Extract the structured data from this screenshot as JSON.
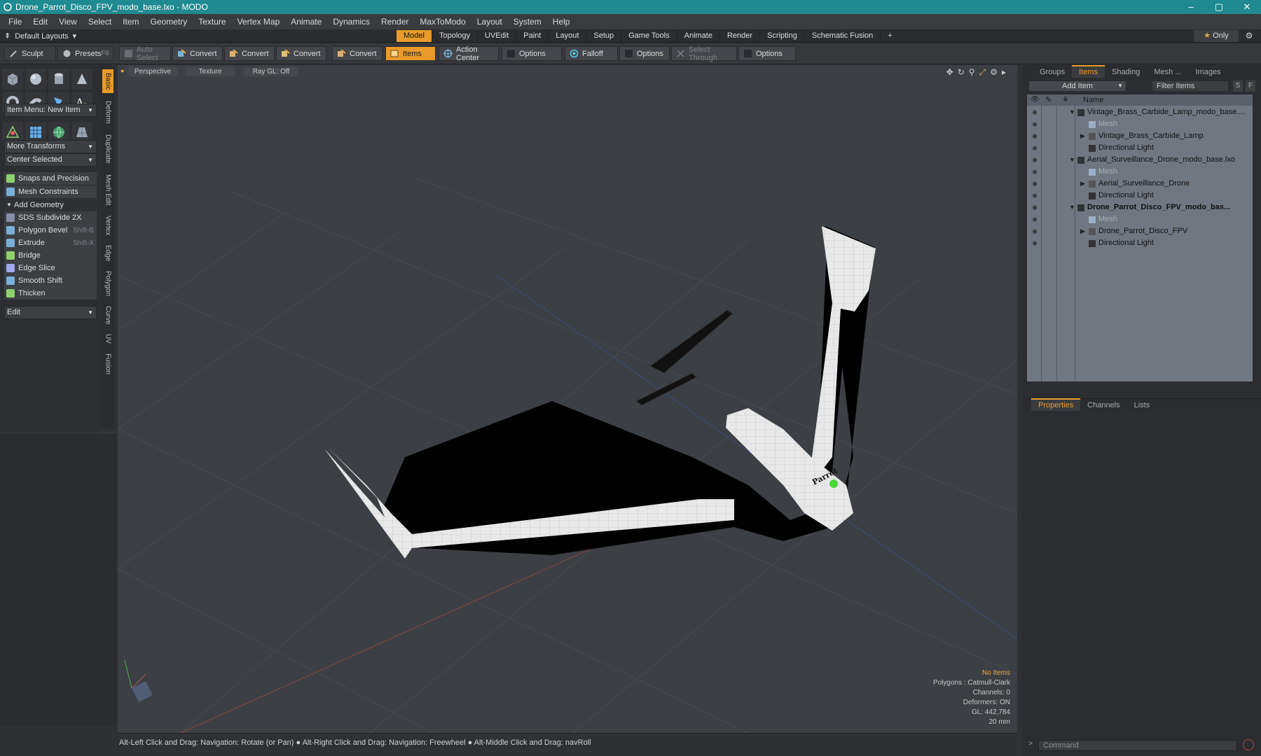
{
  "window": {
    "title": "Drone_Parrot_Disco_FPV_modo_base.lxo - MODO",
    "controls": [
      "–",
      "▢",
      "✕"
    ]
  },
  "menu": [
    "File",
    "Edit",
    "View",
    "Select",
    "Item",
    "Geometry",
    "Texture",
    "Vertex Map",
    "Animate",
    "Dynamics",
    "Render",
    "MaxToModo",
    "Layout",
    "System",
    "Help"
  ],
  "layoutbar": {
    "layouts_label": "Default Layouts",
    "tabs": [
      "Model",
      "Topology",
      "UVEdit",
      "Paint",
      "Layout",
      "Setup",
      "Game Tools",
      "Animate",
      "Render",
      "Scripting",
      "Schematic Fusion"
    ],
    "active_tab": "Model",
    "only_label": "Only",
    "plus": "+"
  },
  "toolbar": {
    "sculpt": "Sculpt",
    "presets": "Presets",
    "presets_key": "F6",
    "auto_select": "Auto Select",
    "convert1": "Convert",
    "convert2": "Convert",
    "convert3": "Convert",
    "convert4": "Convert",
    "items": "Items",
    "action_center": "Action Center",
    "options1": "Options",
    "falloff": "Falloff",
    "options2": "Options",
    "select_through": "Select Through",
    "options3": "Options"
  },
  "left": {
    "item_menu": "Item Menu: New Item",
    "more_transforms": "More Transforms",
    "center_selected": "Center Selected",
    "snaps": "Snaps and Precision",
    "mesh_constraints": "Mesh Constraints",
    "add_geometry": "Add Geometry",
    "tools": [
      {
        "label": "SDS Subdivide 2X",
        "key": "",
        "color": "#8a8fa8"
      },
      {
        "label": "Polygon Bevel",
        "key": "Shift-B",
        "color": "#7ab0d8"
      },
      {
        "label": "Extrude",
        "key": "Shift-X",
        "color": "#7ab0d8"
      },
      {
        "label": "Bridge",
        "key": "",
        "color": "#8fcf6f"
      },
      {
        "label": "Edge Slice",
        "key": "",
        "color": "#9fa8e8"
      },
      {
        "label": "Smooth Shift",
        "key": "",
        "color": "#7ab0d8"
      },
      {
        "label": "Thicken",
        "key": "",
        "color": "#8fcf6f"
      }
    ],
    "edit": "Edit"
  },
  "vtabs": [
    "Basic",
    "Deform",
    "Duplicate",
    "Mesh Edit",
    "Vertex",
    "Edge",
    "Polygon",
    "Curve",
    "UV",
    "Fusion"
  ],
  "viewport": {
    "perspective": "Perspective",
    "texture": "Texture",
    "raygl": "Ray GL: Off",
    "logo_text": "Parrot",
    "info": {
      "no_items": "No Items",
      "polygons": "Polygons : Catmull-Clark",
      "channels": "Channels: 0",
      "deformers": "Deformers: ON",
      "gl": "GL: 442,784",
      "scale": "20 mm"
    }
  },
  "status": "Alt-Left Click and Drag: Navigation: Rotate (or Pan) ● Alt-Right Click and Drag: Navigation: Freewheel ● Alt-Middle Click and Drag: navRoll",
  "right": {
    "tabs": [
      "Groups",
      "Items",
      "Shading",
      "Mesh ...",
      "Images"
    ],
    "active_tab": "Items",
    "add_item": "Add Item",
    "filter": "Filter Items",
    "s": "S",
    "f": "F",
    "name_col": "Name",
    "tree": [
      {
        "label": "Vintage_Brass_Carbide_Lamp_modo_base....",
        "type": "scene",
        "indent": 0,
        "dim": false,
        "bold": false
      },
      {
        "label": "Mesh",
        "type": "mesh",
        "indent": 1,
        "dim": true,
        "bold": false
      },
      {
        "label": "Vintage_Brass_Carbide_Lamp",
        "type": "group",
        "indent": 1,
        "dim": false,
        "bold": false
      },
      {
        "label": "Directional Light",
        "type": "light",
        "indent": 1,
        "dim": false,
        "bold": false
      },
      {
        "label": "Aerial_Surveillance_Drone_modo_base.lxo",
        "type": "scene",
        "indent": 0,
        "dim": false,
        "bold": false
      },
      {
        "label": "Mesh",
        "type": "mesh",
        "indent": 1,
        "dim": true,
        "bold": false
      },
      {
        "label": "Aerial_Surveillance_Drone",
        "type": "group",
        "indent": 1,
        "dim": false,
        "bold": false
      },
      {
        "label": "Directional Light",
        "type": "light",
        "indent": 1,
        "dim": false,
        "bold": false
      },
      {
        "label": "Drone_Parrot_Disco_FPV_modo_bas...",
        "type": "scene",
        "indent": 0,
        "dim": false,
        "bold": true
      },
      {
        "label": "Mesh",
        "type": "mesh",
        "indent": 1,
        "dim": true,
        "bold": false
      },
      {
        "label": "Drone_Parrot_Disco_FPV",
        "type": "group",
        "indent": 1,
        "dim": false,
        "bold": false
      },
      {
        "label": "Directional Light",
        "type": "light",
        "indent": 1,
        "dim": false,
        "bold": false
      }
    ],
    "ptabs": [
      "Properties",
      "Channels",
      "Lists"
    ],
    "active_ptab": "Properties",
    "command_placeholder": "Command"
  },
  "colors": {
    "accent": "#e89a2a",
    "titlebar": "#1f8a8f"
  }
}
